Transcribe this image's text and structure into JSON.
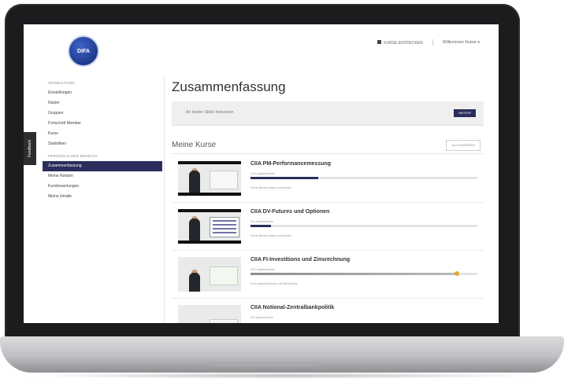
{
  "app": {
    "logo_text": "DIFA"
  },
  "topnav": {
    "all_courses": "KURSE ENTDECKEN",
    "user": "Willkommen Nutzer ▾"
  },
  "feedback_tab": "Feedback",
  "sidebar": {
    "section_admin": "VERWALTUNG",
    "admin_items": [
      "Einstellungen",
      "Nutzer",
      "Gruppen",
      "Fortschritt Member",
      "Kurse",
      "Statistiken"
    ],
    "section_personal": "PERSÖNLICHER BEREICH",
    "personal_items": [
      "Zusammenfassung",
      "Meine Notizen",
      "Kursbewertungen",
      "Meine Inhalte"
    ],
    "active_index": 0
  },
  "main": {
    "title": "Zusammenfassung",
    "resume_text": "An letzter Stelle fortsetzen",
    "resume_button": "WEITER",
    "my_courses": "Meine Kurse",
    "all_button": "ALLE ANZEIGEN"
  },
  "courses": [
    {
      "title": "CIIA PM-Performancemessung",
      "progress_text": "41% abgeschlossen",
      "progress": 0.3,
      "status": "Keine Bewertungen vorhanden",
      "style": "navy"
    },
    {
      "title": "CIIA DV-Futures und Optionen",
      "progress_text": "9% abgeschlossen",
      "progress": 0.09,
      "status": "Keine Bewertungen vorhanden",
      "style": "navy"
    },
    {
      "title": "CIIA FI-Investitions und Zinsrechnung",
      "progress_text": "91% abgeschlossen",
      "progress": 0.91,
      "status": "Kurs abgeschlossen mit Bewertung",
      "style": "gold"
    },
    {
      "title": "CIIA Notional-Zentralbankpolitik",
      "progress_text": "8% abgeschlossen",
      "progress": 0.08,
      "status": "",
      "style": "navy"
    }
  ],
  "colors": {
    "accent": "#2b2d5c",
    "progress_done": "#e5a823"
  }
}
